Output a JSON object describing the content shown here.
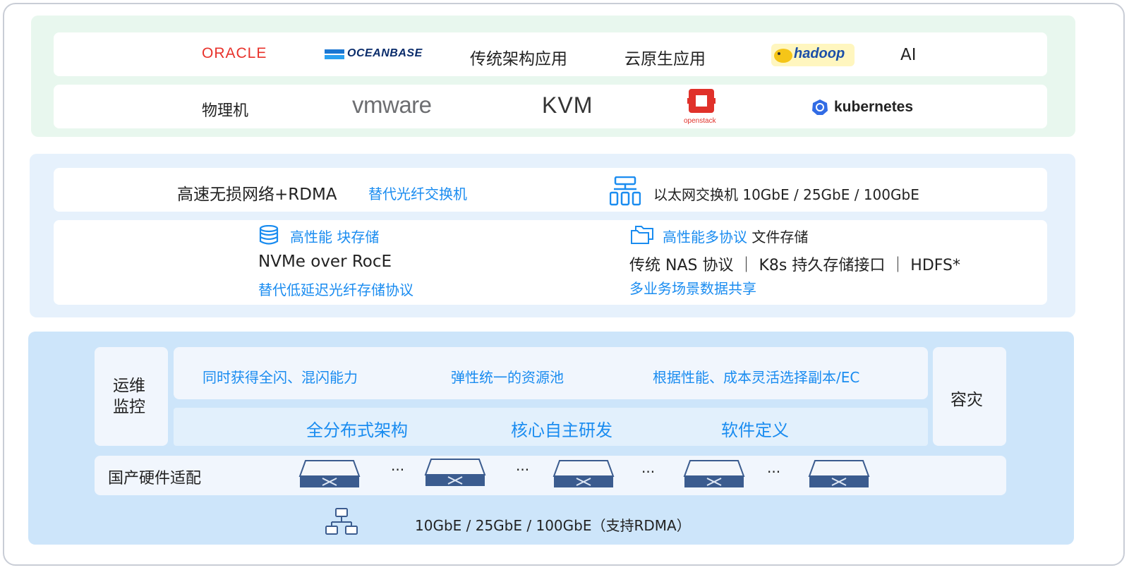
{
  "apps_row": {
    "oracle": "ORACLE",
    "oceanbase": "OCEANBASE",
    "traditional": "传统架构应用",
    "cloud_native": "云原生应用",
    "hadoop": "hadoop",
    "ai": "AI"
  },
  "platform_row": {
    "physical": "物理机",
    "vmware": "vmware",
    "kvm": "KVM",
    "openstack": "openstack",
    "kubernetes": "kubernetes"
  },
  "network_row": {
    "title": "高速无损网络+RDMA",
    "subtitle": "替代光纤交换机",
    "switch_text": "以太网交换机 10GbE / 25GbE / 100GbE"
  },
  "block_storage": {
    "heading": "高性能 块存储",
    "main": "NVMe over RocE",
    "sub": "替代低延迟光纤存储协议"
  },
  "file_storage": {
    "heading_blue": "高性能多协议",
    "heading_dark": "文件存储",
    "main": "传统 NAS 协议  ｜ K8s 持久存储接口  ｜ HDFS*",
    "sub": "多业务场景数据共享"
  },
  "core": {
    "ops": [
      "运维",
      "监控"
    ],
    "dr": "容灾",
    "features": [
      "同时获得全闪、混闪能力",
      "弹性统一的资源池",
      "根据性能、成本灵活选择副本/EC"
    ],
    "pillars": [
      "全分布式架构",
      "核心自主研发",
      "软件定义"
    ],
    "hardware_label": "国产硬件适配",
    "ellipsis": "···",
    "network": "10GbE / 25GbE / 100GbE（支持RDMA）"
  },
  "colors": {
    "accent_blue": "#1a8cf0",
    "apps_bg": "#e8f7ee",
    "storage_bg": "#e6f1fc",
    "core_bg": "#cde5fa",
    "oracle_red": "#e8322b"
  }
}
